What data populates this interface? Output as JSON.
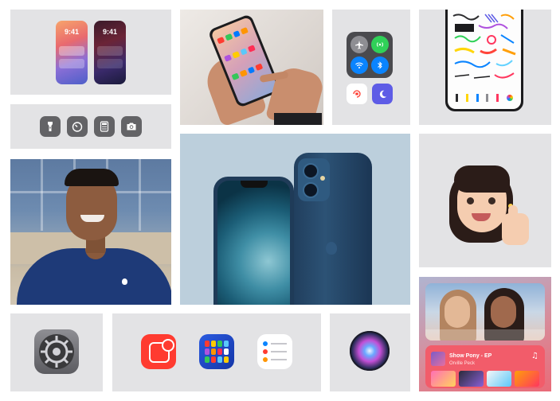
{
  "wallpaper_tile": {
    "light_phone_time": "9:41",
    "dark_phone_time": "9:41"
  },
  "quick_icons": [
    {
      "name": "flashlight-icon"
    },
    {
      "name": "timer-icon"
    },
    {
      "name": "calculator-icon"
    },
    {
      "name": "camera-icon"
    }
  ],
  "control_center": {
    "buttons": [
      "airplane-mode-icon",
      "cellular-icon",
      "wifi-icon",
      "bluetooth-icon"
    ],
    "extras": [
      "orientation-lock-icon",
      "do-not-disturb-icon"
    ]
  },
  "music_widget": {
    "title": "Show Pony - EP",
    "artist": "Orville Peck"
  },
  "colors": {
    "tile_background": "#e3e3e5",
    "iphone_blue": "#1f3f5e",
    "facetime_blue_bg": "#b9ccda",
    "widget_red": "#f25c6a"
  }
}
